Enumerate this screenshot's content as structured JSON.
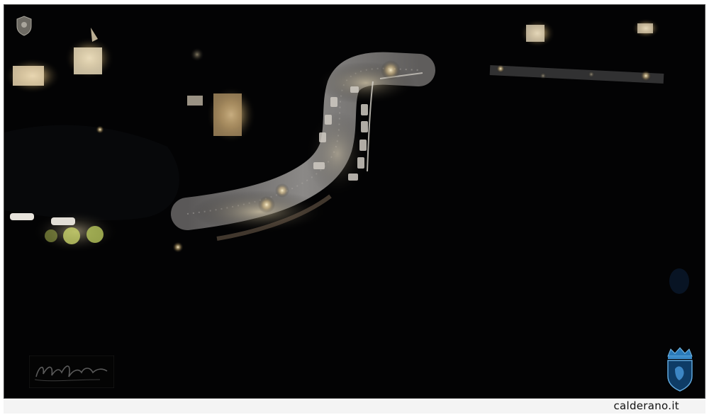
{
  "footer": {
    "site_label": "calderano.it"
  },
  "photo": {
    "subject": "night-aerial-winding-road",
    "colors": {
      "background": "#030304",
      "road": "#6f6e70",
      "lamp_glow": "#f3e6c2",
      "building": "#e8d9b8"
    }
  },
  "icons": {
    "top_left_emblem": "crest-icon",
    "bottom_right_emblem": "crowned-shield-crest-icon",
    "bottom_left_signature": "signature-icon"
  }
}
